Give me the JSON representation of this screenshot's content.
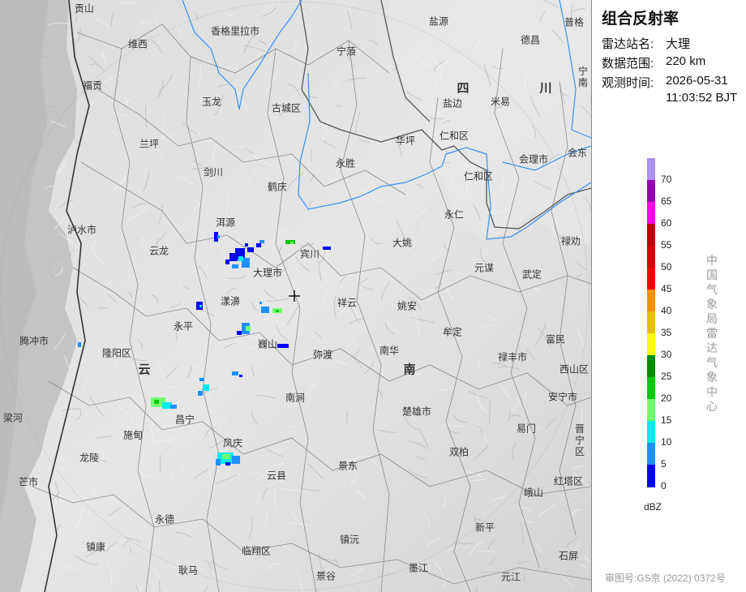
{
  "panel": {
    "title": "组合反射率",
    "station_label": "雷达站名:",
    "station_value": "大理",
    "range_label": "数据范围:",
    "range_value": "220 km",
    "time_label": "观测时间:",
    "time_date": "2026-05-31",
    "time_clock": "11:03:52 BJT",
    "unit": "dBZ",
    "org": "中国气象局雷达气象中心",
    "credit": "审图号:GS京 (2022) 0372号"
  },
  "legend": {
    "labels": [
      "70",
      "65",
      "60",
      "55",
      "50",
      "45",
      "40",
      "35",
      "30",
      "25",
      "20",
      "15",
      "10",
      "5",
      "0"
    ],
    "colors": [
      "#ad90f0",
      "#9600b4",
      "#ff00f0",
      "#c00000",
      "#d60000",
      "#ff0000",
      "#ff9000",
      "#e7c000",
      "#ffff00",
      "#008e00",
      "#00c800",
      "#72ff70",
      "#00ecec",
      "#1e90ff",
      "#0000f6"
    ]
  },
  "map": {
    "provinces": [
      {
        "name": "四",
        "id": "si"
      },
      {
        "name": "川",
        "id": "chuan"
      },
      {
        "name": "云",
        "id": "yun"
      },
      {
        "name": "南",
        "id": "nan"
      }
    ],
    "cities": [
      "贡山",
      "维西",
      "香格里拉市",
      "宁蒗",
      "盐源",
      "德昌",
      "普格",
      "宁南",
      "福贡",
      "玉龙",
      "古城区",
      "盐边",
      "米易",
      "兰坪",
      "华坪",
      "仁和区",
      "会理市",
      "会东",
      "剑川",
      "永胜",
      "仁和区",
      "泸水市",
      "鹤庆",
      "洱源",
      "永仁",
      "大姚",
      "禄劝",
      "云龙",
      "宾川",
      "大理市",
      "元谋",
      "武定",
      "漾濞",
      "祥云",
      "永平",
      "姚安",
      "牟定",
      "富民",
      "腾冲市",
      "隆阳区",
      "巍山",
      "弥渡",
      "南华",
      "禄丰市",
      "西山区",
      "南涧",
      "安宁市",
      "楚雄市",
      "昌宁",
      "施甸",
      "梁河",
      "凤庆",
      "易门",
      "晋宁区",
      "双柏",
      "龙陵",
      "景东",
      "芒市",
      "云县",
      "红塔区",
      "峨山",
      "永德",
      "新平",
      "镇康",
      "临翔区",
      "镇沅",
      "石屏",
      "耿马",
      "景谷",
      "墨江",
      "元江"
    ]
  }
}
